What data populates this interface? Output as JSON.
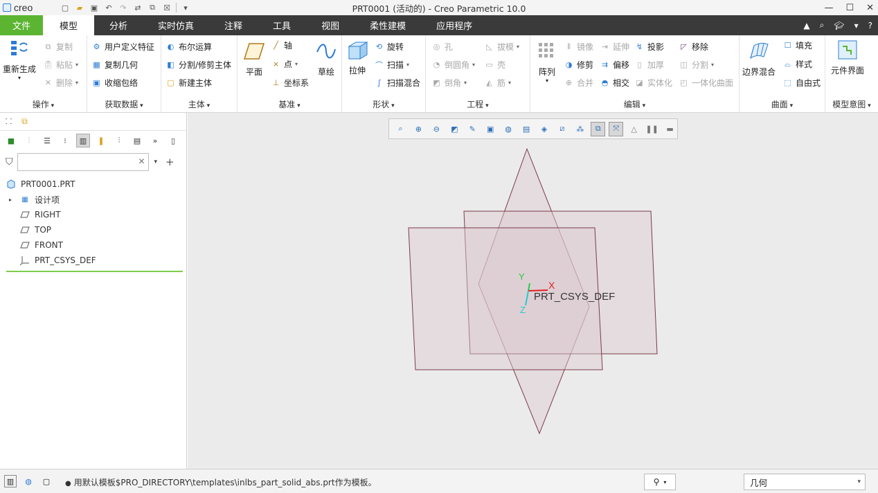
{
  "app": {
    "logo_text": "creo",
    "window_title": "PRT0001 (活动的) - Creo Parametric 10.0"
  },
  "tabs": [
    {
      "label": "文件"
    },
    {
      "label": "模型"
    },
    {
      "label": "分析"
    },
    {
      "label": "实时仿真"
    },
    {
      "label": "注释"
    },
    {
      "label": "工具"
    },
    {
      "label": "视图"
    },
    {
      "label": "柔性建模"
    },
    {
      "label": "应用程序"
    }
  ],
  "ribbon": {
    "ops": {
      "label": "操作",
      "regenerate": "重新生成",
      "copy": "复制",
      "paste": "粘贴",
      "delete": "删除"
    },
    "getdata": {
      "label": "获取数据",
      "udf": "用户定义特征",
      "copygeom": "复制几何",
      "shrinkwrap": "收缩包络"
    },
    "body": {
      "label": "主体",
      "boolean": "布尔运算",
      "splittrim": "分割/修剪主体",
      "newbody": "新建主体"
    },
    "datum": {
      "label": "基准",
      "plane": "平面",
      "axis": "轴",
      "point": "点",
      "csys": "坐标系",
      "sketch": "草绘"
    },
    "shape": {
      "label": "形状",
      "extrude": "拉伸",
      "revolve": "旋转",
      "sweep": "扫描",
      "sweptblend": "扫描混合"
    },
    "engineering": {
      "label": "工程",
      "hole": "孔",
      "round": "倒圆角",
      "chamfer": "倒角",
      "draft": "拔模",
      "shell": "壳",
      "rib": "筋"
    },
    "editing": {
      "label": "编辑",
      "pattern": "阵列",
      "mirror": "镜像",
      "trim": "修剪",
      "merge": "合并",
      "extend": "延伸",
      "offset": "偏移",
      "intersect": "相交",
      "project": "投影",
      "thicken": "加厚",
      "solidify": "实体化",
      "remove": "移除",
      "split": "分割",
      "unify": "一体化曲面"
    },
    "surfaces": {
      "label": "曲面",
      "boundary": "边界混合",
      "fill": "填充",
      "style": "样式",
      "freestyle": "自由式"
    },
    "intent": {
      "label": "模型意图",
      "component_interface": "元件界面"
    }
  },
  "tree": {
    "root": "PRT0001.PRT",
    "items": [
      {
        "label": "设计项"
      },
      {
        "label": "RIGHT"
      },
      {
        "label": "TOP"
      },
      {
        "label": "FRONT"
      },
      {
        "label": "PRT_CSYS_DEF"
      }
    ],
    "search_placeholder": ""
  },
  "scene": {
    "csys_label": "PRT_CSYS_DEF",
    "axis_x": "X",
    "axis_y": "Y",
    "axis_z": "Z",
    "plane_fill": "#dcc9d0",
    "plane_edge": "#7a3a4a"
  },
  "status": {
    "message": "用默认模板$PRO_DIRECTORY\\templates\\inlbs_part_solid_abs.prt作为模板。",
    "selection_filter": "几何"
  }
}
